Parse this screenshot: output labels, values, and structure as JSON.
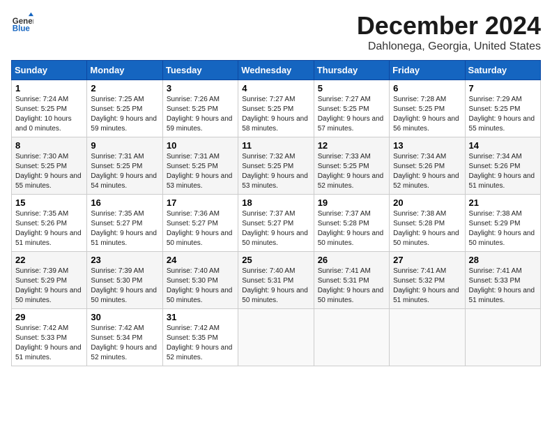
{
  "header": {
    "logo_line1": "General",
    "logo_line2": "Blue",
    "month": "December 2024",
    "location": "Dahlonega, Georgia, United States"
  },
  "weekdays": [
    "Sunday",
    "Monday",
    "Tuesday",
    "Wednesday",
    "Thursday",
    "Friday",
    "Saturday"
  ],
  "weeks": [
    [
      {
        "day": "1",
        "sunrise": "7:24 AM",
        "sunset": "5:25 PM",
        "daylight": "10 hours and 0 minutes."
      },
      {
        "day": "2",
        "sunrise": "7:25 AM",
        "sunset": "5:25 PM",
        "daylight": "9 hours and 59 minutes."
      },
      {
        "day": "3",
        "sunrise": "7:26 AM",
        "sunset": "5:25 PM",
        "daylight": "9 hours and 59 minutes."
      },
      {
        "day": "4",
        "sunrise": "7:27 AM",
        "sunset": "5:25 PM",
        "daylight": "9 hours and 58 minutes."
      },
      {
        "day": "5",
        "sunrise": "7:27 AM",
        "sunset": "5:25 PM",
        "daylight": "9 hours and 57 minutes."
      },
      {
        "day": "6",
        "sunrise": "7:28 AM",
        "sunset": "5:25 PM",
        "daylight": "9 hours and 56 minutes."
      },
      {
        "day": "7",
        "sunrise": "7:29 AM",
        "sunset": "5:25 PM",
        "daylight": "9 hours and 55 minutes."
      }
    ],
    [
      {
        "day": "8",
        "sunrise": "7:30 AM",
        "sunset": "5:25 PM",
        "daylight": "9 hours and 55 minutes."
      },
      {
        "day": "9",
        "sunrise": "7:31 AM",
        "sunset": "5:25 PM",
        "daylight": "9 hours and 54 minutes."
      },
      {
        "day": "10",
        "sunrise": "7:31 AM",
        "sunset": "5:25 PM",
        "daylight": "9 hours and 53 minutes."
      },
      {
        "day": "11",
        "sunrise": "7:32 AM",
        "sunset": "5:25 PM",
        "daylight": "9 hours and 53 minutes."
      },
      {
        "day": "12",
        "sunrise": "7:33 AM",
        "sunset": "5:25 PM",
        "daylight": "9 hours and 52 minutes."
      },
      {
        "day": "13",
        "sunrise": "7:34 AM",
        "sunset": "5:26 PM",
        "daylight": "9 hours and 52 minutes."
      },
      {
        "day": "14",
        "sunrise": "7:34 AM",
        "sunset": "5:26 PM",
        "daylight": "9 hours and 51 minutes."
      }
    ],
    [
      {
        "day": "15",
        "sunrise": "7:35 AM",
        "sunset": "5:26 PM",
        "daylight": "9 hours and 51 minutes."
      },
      {
        "day": "16",
        "sunrise": "7:35 AM",
        "sunset": "5:27 PM",
        "daylight": "9 hours and 51 minutes."
      },
      {
        "day": "17",
        "sunrise": "7:36 AM",
        "sunset": "5:27 PM",
        "daylight": "9 hours and 50 minutes."
      },
      {
        "day": "18",
        "sunrise": "7:37 AM",
        "sunset": "5:27 PM",
        "daylight": "9 hours and 50 minutes."
      },
      {
        "day": "19",
        "sunrise": "7:37 AM",
        "sunset": "5:28 PM",
        "daylight": "9 hours and 50 minutes."
      },
      {
        "day": "20",
        "sunrise": "7:38 AM",
        "sunset": "5:28 PM",
        "daylight": "9 hours and 50 minutes."
      },
      {
        "day": "21",
        "sunrise": "7:38 AM",
        "sunset": "5:29 PM",
        "daylight": "9 hours and 50 minutes."
      }
    ],
    [
      {
        "day": "22",
        "sunrise": "7:39 AM",
        "sunset": "5:29 PM",
        "daylight": "9 hours and 50 minutes."
      },
      {
        "day": "23",
        "sunrise": "7:39 AM",
        "sunset": "5:30 PM",
        "daylight": "9 hours and 50 minutes."
      },
      {
        "day": "24",
        "sunrise": "7:40 AM",
        "sunset": "5:30 PM",
        "daylight": "9 hours and 50 minutes."
      },
      {
        "day": "25",
        "sunrise": "7:40 AM",
        "sunset": "5:31 PM",
        "daylight": "9 hours and 50 minutes."
      },
      {
        "day": "26",
        "sunrise": "7:41 AM",
        "sunset": "5:31 PM",
        "daylight": "9 hours and 50 minutes."
      },
      {
        "day": "27",
        "sunrise": "7:41 AM",
        "sunset": "5:32 PM",
        "daylight": "9 hours and 51 minutes."
      },
      {
        "day": "28",
        "sunrise": "7:41 AM",
        "sunset": "5:33 PM",
        "daylight": "9 hours and 51 minutes."
      }
    ],
    [
      {
        "day": "29",
        "sunrise": "7:42 AM",
        "sunset": "5:33 PM",
        "daylight": "9 hours and 51 minutes."
      },
      {
        "day": "30",
        "sunrise": "7:42 AM",
        "sunset": "5:34 PM",
        "daylight": "9 hours and 52 minutes."
      },
      {
        "day": "31",
        "sunrise": "7:42 AM",
        "sunset": "5:35 PM",
        "daylight": "9 hours and 52 minutes."
      },
      null,
      null,
      null,
      null
    ]
  ]
}
